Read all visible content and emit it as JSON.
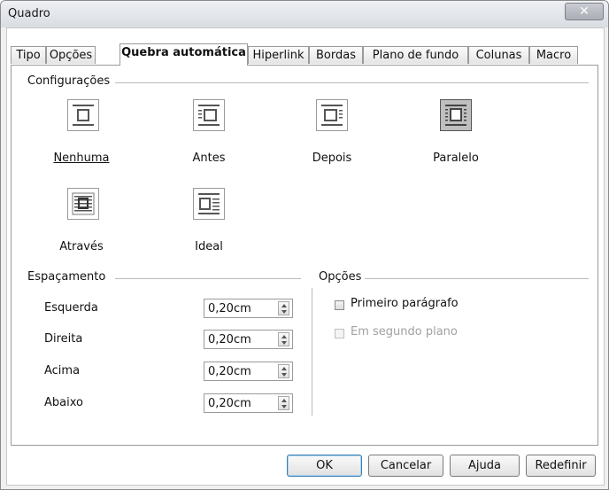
{
  "window": {
    "title": "Quadro",
    "close_glyph": "✕"
  },
  "tabs": [
    {
      "label": "Tipo"
    },
    {
      "label": "Opções"
    },
    {
      "label": "Quebra automática",
      "active": true
    },
    {
      "label": "Hiperlink"
    },
    {
      "label": "Bordas"
    },
    {
      "label": "Plano de fundo"
    },
    {
      "label": "Colunas"
    },
    {
      "label": "Macro"
    }
  ],
  "settings": {
    "label": "Configurações",
    "options": [
      {
        "label": "Nenhuma",
        "icon": "wrap-none-icon",
        "selected": false
      },
      {
        "label": "Antes",
        "icon": "wrap-before-icon",
        "selected": false
      },
      {
        "label": "Depois",
        "icon": "wrap-after-icon",
        "selected": false
      },
      {
        "label": "Paralelo",
        "icon": "wrap-parallel-icon",
        "selected": true
      },
      {
        "label": "Através",
        "icon": "wrap-through-icon",
        "selected": false
      },
      {
        "label": "Ideal",
        "icon": "wrap-optimal-icon",
        "selected": false
      }
    ]
  },
  "spacing": {
    "label": "Espaçamento",
    "rows": [
      {
        "label": "Esquerda",
        "value": "0,20cm"
      },
      {
        "label": "Direita",
        "value": "0,20cm"
      },
      {
        "label": "Acima",
        "value": "0,20cm"
      },
      {
        "label": "Abaixo",
        "value": "0,20cm"
      }
    ]
  },
  "options": {
    "label": "Opções",
    "first_paragraph": {
      "label": "Primeiro parágrafo",
      "checked": false,
      "enabled": true
    },
    "in_background": {
      "label": "Em segundo plano",
      "checked": false,
      "enabled": false
    }
  },
  "buttons": {
    "ok": "OK",
    "cancel": "Cancelar",
    "help": "Ajuda",
    "reset": "Redefinir"
  }
}
